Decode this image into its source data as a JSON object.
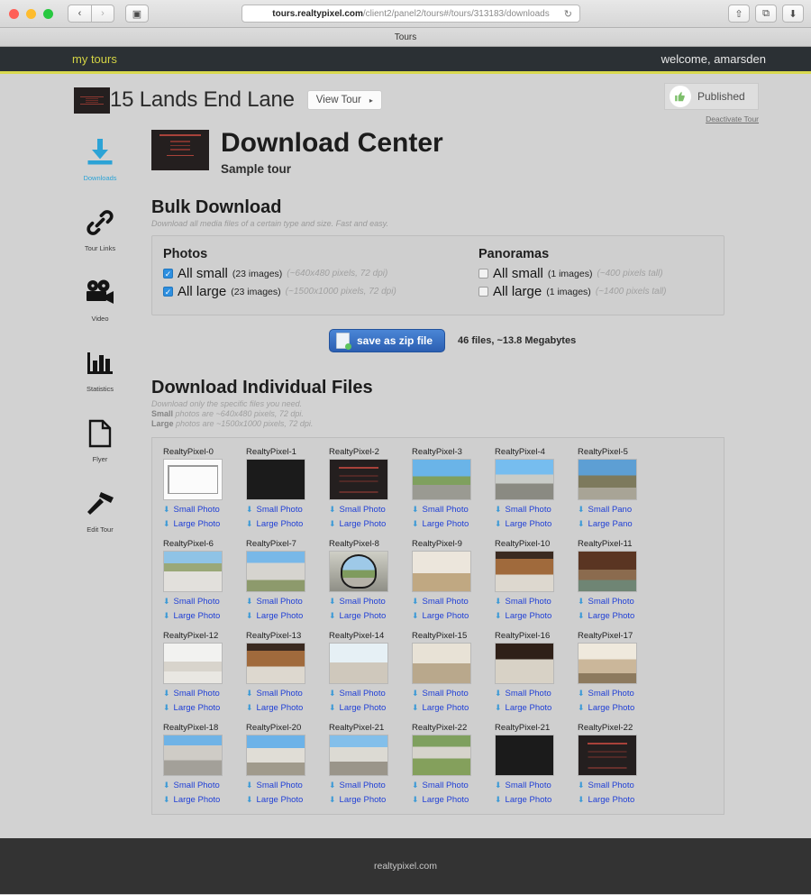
{
  "browser": {
    "url_host": "tours.realtypixel.com",
    "url_path": "/client2/panel2/tours#/tours/313183/downloads",
    "tab_title": "Tours",
    "back_glyph": "‹",
    "forward_glyph": "›",
    "sidebar_toggle_glyph": "▣",
    "reload_glyph": "↻",
    "share_glyph": "⇧",
    "tabs_glyph": "⧉",
    "downloads_glyph": "⬇"
  },
  "site_nav": {
    "my_tours": "my tours",
    "welcome": "welcome, amarsden"
  },
  "page_header": {
    "address": "15 Lands End Lane",
    "view_tour": "View Tour",
    "view_tour_caret": "▸",
    "published_label": "Published",
    "thumbs_up_glyph": "👍",
    "deactivate": "Deactivate Tour"
  },
  "sidebar": {
    "items": [
      {
        "label": "Downloads",
        "icon": "download-arrow-icon",
        "active": true
      },
      {
        "label": "Tour Links",
        "icon": "chain-link-icon",
        "active": false
      },
      {
        "label": "Video",
        "icon": "movie-camera-icon",
        "active": false
      },
      {
        "label": "Statistics",
        "icon": "bar-chart-icon",
        "active": false
      },
      {
        "label": "Flyer",
        "icon": "page-icon",
        "active": false
      },
      {
        "label": "Edit Tour",
        "icon": "hammer-icon",
        "active": false
      }
    ]
  },
  "download_center": {
    "title": "Download Center",
    "subtitle": "Sample tour"
  },
  "bulk": {
    "title": "Bulk Download",
    "subtitle": "Download all media files of a certain type and size. Fast and easy.",
    "photos": {
      "heading": "Photos",
      "rows": [
        {
          "label": "All small",
          "count": "(23 images)",
          "dims": "(~640x480 pixels, 72 dpi)",
          "checked": true
        },
        {
          "label": "All large",
          "count": "(23 images)",
          "dims": "(~1500x1000 pixels, 72 dpi)",
          "checked": true
        }
      ]
    },
    "panoramas": {
      "heading": "Panoramas",
      "rows": [
        {
          "label": "All small",
          "count": "(1 images)",
          "dims": "(~400 pixels tall)",
          "checked": false
        },
        {
          "label": "All large",
          "count": "(1 images)",
          "dims": "(~1400 pixels tall)",
          "checked": false
        }
      ]
    },
    "zip_button": "save as zip file",
    "zip_info": "46 files, ~13.8 Megabytes",
    "checkmark": "✓"
  },
  "individual": {
    "title": "Download Individual Files",
    "line1": "Download only the specific files you need.",
    "line2_bold": "Small",
    "line2_rest": " photos are ~640x480 pixels, 72 dpi.",
    "line3_bold": "Large",
    "line3_rest": " photos are ~1500x1000 pixels, 72 dpi.",
    "download_icon": "⬇",
    "files": [
      {
        "name": "RealtyPixel-0",
        "small": "Small Photo",
        "large": "Large Photo",
        "art": "th-floor"
      },
      {
        "name": "RealtyPixel-1",
        "small": "Small Photo",
        "large": "Large Photo",
        "art": "th-black"
      },
      {
        "name": "RealtyPixel-2",
        "small": "Small Photo",
        "large": "Large Photo",
        "art": "th-logo"
      },
      {
        "name": "RealtyPixel-3",
        "small": "Small Photo",
        "large": "Large Photo",
        "art": "th-ext"
      },
      {
        "name": "RealtyPixel-4",
        "small": "Small Photo",
        "large": "Large Photo",
        "art": "th-ext2"
      },
      {
        "name": "RealtyPixel-5",
        "small": "Small Pano",
        "large": "Large Pano",
        "art": "th-pano"
      },
      {
        "name": "RealtyPixel-6",
        "small": "Small Photo",
        "large": "Large Photo",
        "art": "th-deck"
      },
      {
        "name": "RealtyPixel-7",
        "small": "Small Photo",
        "large": "Large Photo",
        "art": "th-porch"
      },
      {
        "name": "RealtyPixel-8",
        "small": "Small Photo",
        "large": "Large Photo",
        "art": "th-arch"
      },
      {
        "name": "RealtyPixel-9",
        "small": "Small Photo",
        "large": "Large Photo",
        "art": "th-int1"
      },
      {
        "name": "RealtyPixel-10",
        "small": "Small Photo",
        "large": "Large Photo",
        "art": "th-kitch"
      },
      {
        "name": "RealtyPixel-11",
        "small": "Small Photo",
        "large": "Large Photo",
        "art": "th-kitch2"
      },
      {
        "name": "RealtyPixel-12",
        "small": "Small Photo",
        "large": "Large Photo",
        "art": "th-kitwhite"
      },
      {
        "name": "RealtyPixel-13",
        "small": "Small Photo",
        "large": "Large Photo",
        "art": "th-kitch"
      },
      {
        "name": "RealtyPixel-14",
        "small": "Small Photo",
        "large": "Large Photo",
        "art": "th-bright"
      },
      {
        "name": "RealtyPixel-15",
        "small": "Small Photo",
        "large": "Large Photo",
        "art": "th-din"
      },
      {
        "name": "RealtyPixel-16",
        "small": "Small Photo",
        "large": "Large Photo",
        "art": "th-dark-int"
      },
      {
        "name": "RealtyPixel-17",
        "small": "Small Photo",
        "large": "Large Photo",
        "art": "th-din2"
      },
      {
        "name": "RealtyPixel-18",
        "small": "Small Photo",
        "large": "Large Photo",
        "art": "th-house1"
      },
      {
        "name": "RealtyPixel-20",
        "small": "Small Photo",
        "large": "Large Photo",
        "art": "th-house2"
      },
      {
        "name": "RealtyPixel-21",
        "small": "Small Photo",
        "large": "Large Photo",
        "art": "th-house3"
      },
      {
        "name": "RealtyPixel-22",
        "small": "Small Photo",
        "large": "Large Photo",
        "art": "th-aerial"
      },
      {
        "name": "RealtyPixel-21",
        "small": "Small Photo",
        "large": "Large Photo",
        "art": "th-black"
      },
      {
        "name": "RealtyPixel-22",
        "small": "Small Photo",
        "large": "Large Photo",
        "art": "th-logo"
      }
    ]
  },
  "footer": {
    "text": "realtypixel.com"
  }
}
